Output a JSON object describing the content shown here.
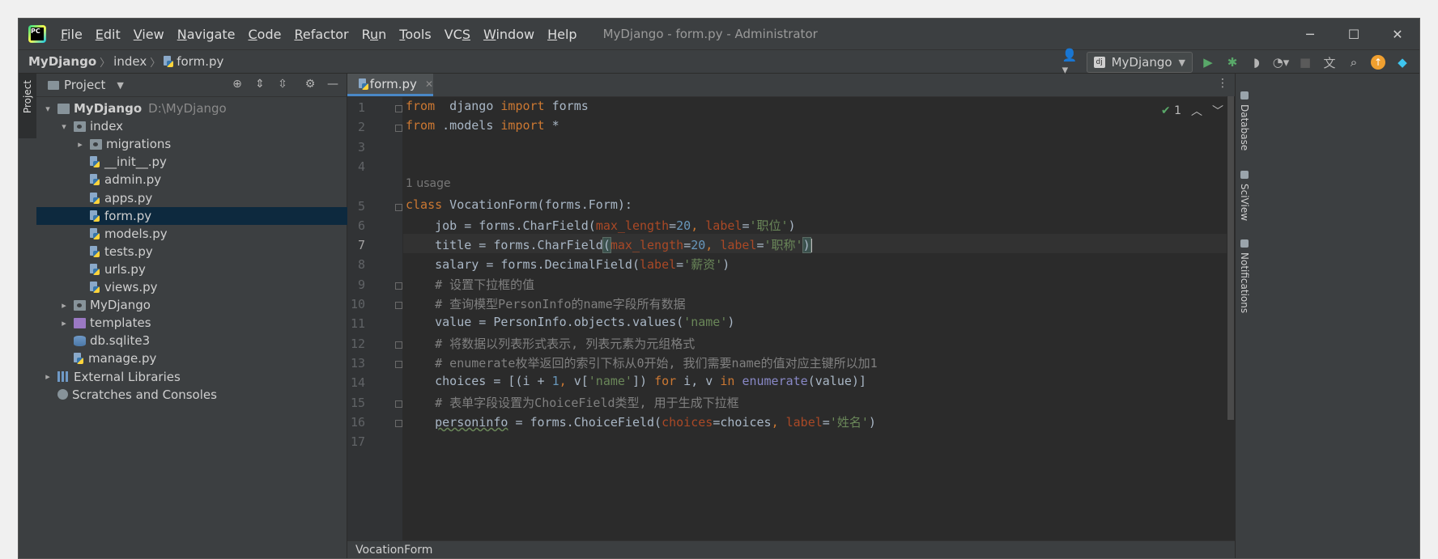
{
  "app": {
    "window_title": "MyDjango - form.py - Administrator",
    "menu": [
      {
        "pre": "",
        "u": "F",
        "post": "ile"
      },
      {
        "pre": "",
        "u": "E",
        "post": "dit"
      },
      {
        "pre": "",
        "u": "V",
        "post": "iew"
      },
      {
        "pre": "",
        "u": "N",
        "post": "avigate"
      },
      {
        "pre": "",
        "u": "C",
        "post": "ode"
      },
      {
        "pre": "",
        "u": "R",
        "post": "efactor"
      },
      {
        "pre": "R",
        "u": "u",
        "post": "n"
      },
      {
        "pre": "",
        "u": "T",
        "post": "ools"
      },
      {
        "pre": "VC",
        "u": "S",
        "post": ""
      },
      {
        "pre": "",
        "u": "W",
        "post": "indow"
      },
      {
        "pre": "",
        "u": "H",
        "post": "elp"
      }
    ],
    "window_buttons": {
      "minimize": "─",
      "maximize": "☐",
      "close": "✕"
    }
  },
  "navbar": {
    "crumbs": [
      "MyDjango",
      "index",
      "form.py"
    ],
    "run_config": "MyDjango",
    "run_config_badge": "dj"
  },
  "left_stripe": {
    "label": "Project"
  },
  "project_panel": {
    "title": "Project",
    "tree": [
      {
        "indent": 0,
        "arrow": "▾",
        "icon": "folder",
        "label": "MyDjango",
        "hint": "D:\\MyDjango",
        "bold": true
      },
      {
        "indent": 1,
        "arrow": "▾",
        "icon": "folder pkg",
        "label": "index",
        "hint": ""
      },
      {
        "indent": 2,
        "arrow": "▸",
        "icon": "folder pkg",
        "label": "migrations",
        "hint": ""
      },
      {
        "indent": 2,
        "arrow": "",
        "icon": "py",
        "label": "__init__.py",
        "hint": ""
      },
      {
        "indent": 2,
        "arrow": "",
        "icon": "py",
        "label": "admin.py",
        "hint": ""
      },
      {
        "indent": 2,
        "arrow": "",
        "icon": "py",
        "label": "apps.py",
        "hint": ""
      },
      {
        "indent": 2,
        "arrow": "",
        "icon": "py",
        "label": "form.py",
        "hint": "",
        "selected": true
      },
      {
        "indent": 2,
        "arrow": "",
        "icon": "py",
        "label": "models.py",
        "hint": ""
      },
      {
        "indent": 2,
        "arrow": "",
        "icon": "py",
        "label": "tests.py",
        "hint": ""
      },
      {
        "indent": 2,
        "arrow": "",
        "icon": "py",
        "label": "urls.py",
        "hint": ""
      },
      {
        "indent": 2,
        "arrow": "",
        "icon": "py",
        "label": "views.py",
        "hint": ""
      },
      {
        "indent": 1,
        "arrow": "▸",
        "icon": "folder pkg",
        "label": "MyDjango",
        "hint": ""
      },
      {
        "indent": 1,
        "arrow": "▸",
        "icon": "folder tpl",
        "label": "templates",
        "hint": ""
      },
      {
        "indent": 1,
        "arrow": "",
        "icon": "db",
        "label": "db.sqlite3",
        "hint": ""
      },
      {
        "indent": 1,
        "arrow": "",
        "icon": "py",
        "label": "manage.py",
        "hint": ""
      },
      {
        "indent": 0,
        "arrow": "▸",
        "icon": "lib",
        "label": "External Libraries",
        "hint": ""
      },
      {
        "indent": 0,
        "arrow": "",
        "icon": "scr",
        "label": "Scratches and Consoles",
        "hint": ""
      }
    ]
  },
  "editor": {
    "tab": "form.py",
    "inspection_count": "1",
    "usage_hint": "1 usage",
    "bottom_breadcrumb": "VocationForm",
    "lines": [
      {
        "n": "1",
        "segs": [
          [
            "k",
            "from"
          ],
          [
            "",
            "  django "
          ],
          [
            "k",
            "import"
          ],
          [
            "",
            " forms"
          ]
        ]
      },
      {
        "n": "2",
        "segs": [
          [
            "k",
            "from"
          ],
          [
            "",
            " .models "
          ],
          [
            "k",
            "import"
          ],
          [
            "",
            " *"
          ]
        ]
      },
      {
        "n": "3",
        "segs": []
      },
      {
        "n": "4",
        "segs": []
      },
      {
        "n": "5",
        "segs": [
          [
            "k",
            "class"
          ],
          [
            "",
            " VocationForm(forms.Form):"
          ]
        ]
      },
      {
        "n": "6",
        "segs": [
          [
            "",
            "    job = forms.CharField("
          ],
          [
            "p",
            "max_length"
          ],
          [
            "",
            "="
          ],
          [
            "n",
            "20"
          ],
          [
            "k",
            ", "
          ],
          [
            "p",
            "label"
          ],
          [
            "",
            "="
          ],
          [
            "s",
            "'职位'"
          ],
          [
            "",
            ")"
          ]
        ]
      },
      {
        "n": "7",
        "segs": [
          [
            "",
            "    title = forms.CharField"
          ],
          [
            "m",
            "("
          ],
          [
            "p",
            "max_length"
          ],
          [
            "",
            "="
          ],
          [
            "n",
            "20"
          ],
          [
            "k",
            ", "
          ],
          [
            "p",
            "label"
          ],
          [
            "",
            "="
          ],
          [
            "s",
            "'职称'"
          ],
          [
            "m",
            ")"
          ],
          [
            "cur",
            ""
          ]
        ]
      },
      {
        "n": "8",
        "segs": [
          [
            "",
            "    salary = forms.DecimalField("
          ],
          [
            "p",
            "label"
          ],
          [
            "",
            "="
          ],
          [
            "s",
            "'薪资'"
          ],
          [
            "",
            ")"
          ]
        ]
      },
      {
        "n": "9",
        "segs": [
          [
            "c",
            "    # 设置下拉框的值"
          ]
        ]
      },
      {
        "n": "10",
        "segs": [
          [
            "c",
            "    # 查询模型PersonInfo的name字段所有数据"
          ]
        ]
      },
      {
        "n": "11",
        "segs": [
          [
            "",
            "    value = PersonInfo.objects.values("
          ],
          [
            "s",
            "'name'"
          ],
          [
            "",
            ")"
          ]
        ]
      },
      {
        "n": "12",
        "segs": [
          [
            "c",
            "    # 将数据以列表形式表示, 列表元素为元组格式"
          ]
        ]
      },
      {
        "n": "13",
        "segs": [
          [
            "c",
            "    # enumerate枚举返回的索引下标从0开始, 我们需要name的值对应主键所以加1"
          ]
        ]
      },
      {
        "n": "14",
        "segs": [
          [
            "",
            "    choices = [(i + "
          ],
          [
            "n",
            "1"
          ],
          [
            "k",
            ", "
          ],
          [
            "",
            "v["
          ],
          [
            "s",
            "'name'"
          ],
          [
            "",
            "]) "
          ],
          [
            "k",
            "for"
          ],
          [
            "",
            " i, v "
          ],
          [
            "k",
            "in"
          ],
          [
            "",
            " "
          ],
          [
            "bi",
            "enumerate"
          ],
          [
            "",
            "(value)]"
          ]
        ]
      },
      {
        "n": "15",
        "segs": [
          [
            "c",
            "    # 表单字段设置为ChoiceField类型, 用于生成下拉框"
          ]
        ]
      },
      {
        "n": "16",
        "segs": [
          [
            "",
            "    "
          ],
          [
            "w",
            "personinfo"
          ],
          [
            "",
            " = forms.ChoiceField("
          ],
          [
            "p",
            "choices"
          ],
          [
            "",
            "=choices"
          ],
          [
            "k",
            ", "
          ],
          [
            "p",
            "label"
          ],
          [
            "",
            "="
          ],
          [
            "s",
            "'姓名'"
          ],
          [
            "",
            ")"
          ]
        ]
      },
      {
        "n": "17",
        "segs": []
      }
    ]
  },
  "right_stripe": [
    "Database",
    "SciView",
    "Notifications"
  ],
  "colors": {
    "accent": "#4a88c7",
    "selection": "#0d293e",
    "keyword": "#cc7832",
    "string": "#6a8759",
    "number": "#6897bb"
  }
}
